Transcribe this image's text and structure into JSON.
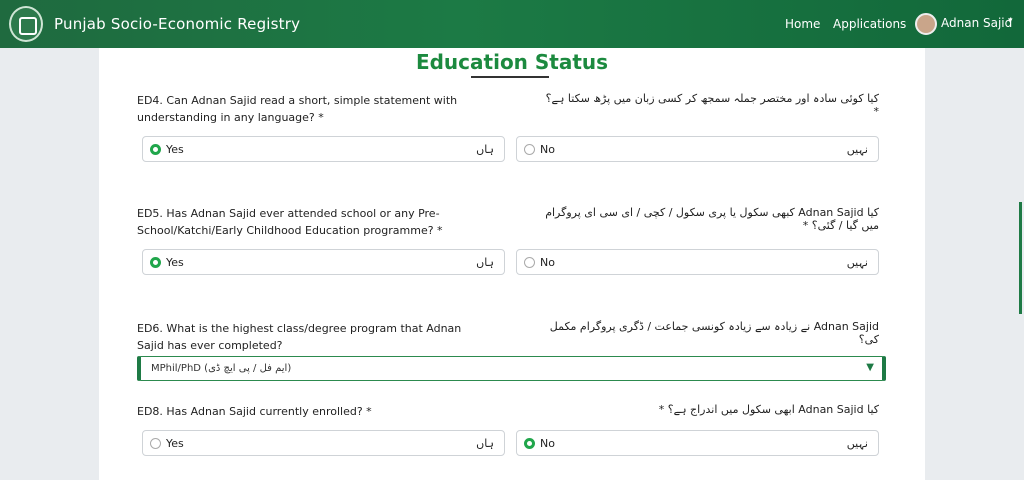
{
  "navbar": {
    "brand": "Punjab Socio-Economic Registry",
    "links": [
      "Home",
      "Applications"
    ],
    "user_name": "Adnan Sajid",
    "caret": "▾"
  },
  "page": {
    "title": "Education Status"
  },
  "questions": [
    {
      "label_en": "ED4. Can Adnan Sajid read a short, simple statement with understanding in any language? *",
      "label_ur": "کیا کوئی سادہ اور مختصر جملہ سمجھ کر کسی زبان میں پڑھ سکتا ہے؟ *",
      "options": [
        {
          "en": "Yes",
          "ur": "ہاں",
          "selected": true
        },
        {
          "en": "No",
          "ur": "نہیں",
          "selected": false
        }
      ]
    },
    {
      "label_en": "ED5. Has Adnan Sajid ever attended school or any Pre-School/Katchi/Early Childhood Education programme? *",
      "label_ur": "کیا Adnan Sajid کبھی سکول یا پری سکول / کچی / ای سی ای پروگرام میں گیا / گئی؟ *",
      "options": [
        {
          "en": "Yes",
          "ur": "ہاں",
          "selected": true
        },
        {
          "en": "No",
          "ur": "نہیں",
          "selected": false
        }
      ]
    },
    {
      "label_en": "ED6. What is the highest class/degree program that Adnan Sajid has ever completed?",
      "label_ur": "Adnan Sajid نے زیادہ سے زیادہ کونسی جماعت / ڈگری پروگرام مکمل کی؟",
      "select_value": "MPhil/PhD (ایم فل / پی ایچ ڈی)",
      "select_arrow": "▼"
    },
    {
      "label_en": "ED8. Has Adnan Sajid currently enrolled? *",
      "label_ur": "کیا Adnan Sajid ابھی سکول میں اندراج ہے؟ *",
      "options": [
        {
          "en": "Yes",
          "ur": "ہاں",
          "selected": false
        },
        {
          "en": "No",
          "ur": "نہیں",
          "selected": true
        }
      ]
    }
  ],
  "colors": {
    "nav": "#1f6a3f",
    "accent": "#20a64b",
    "title": "#1c8a3f"
  }
}
